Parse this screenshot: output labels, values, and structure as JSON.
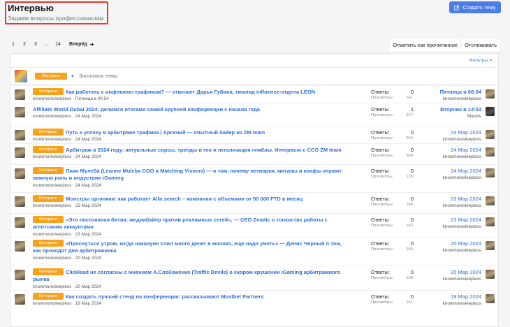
{
  "header": {
    "title": "Интервью",
    "description": "Задаем вопросы профессионалам",
    "create_button": "Создать тему"
  },
  "pagination": {
    "pages": [
      "1",
      "2",
      "3",
      "...",
      "14"
    ],
    "next_label": "Вперёд"
  },
  "actions": {
    "mark_read": "Отметить как прочитанное",
    "watch": "Отслеживать"
  },
  "filters_label": "Фильтры",
  "new_thread": {
    "prefix": "Интервью",
    "placeholder": "Заголовок темы"
  },
  "labels": {
    "replies": "Ответы:",
    "views": "Просмотры:"
  },
  "threads": [
    {
      "prefix": "Интервью",
      "title": "Как работать с инфлюенс-трафиком? — отвечает Дарья Губина, тимлид influence-отдела LEON",
      "author": "knowmoresleepless",
      "date": "Пятница в 00:54",
      "replies": "0",
      "views": "141",
      "last_date": "Пятница в 00:54",
      "last_user": "knowmoresleepless"
    },
    {
      "prefix": "",
      "title": "Affiliate World Dubai 2024: делимся итогами самой крупной конференции с начала года",
      "author": "knowmoresleepless",
      "date": "24 Мар 2024",
      "replies": "1",
      "views": "227",
      "last_date": "Вторник в 14:53",
      "last_user": "Maslov"
    },
    {
      "prefix": "Интервью",
      "title": "Путь к успеху в арбитраже трафика | Арсений — опытный байер из ZM team",
      "author": "knowmoresleepless",
      "date": "24 Мар 2024",
      "replies": "0",
      "views": "254",
      "last_date": "24 Мар 2024",
      "last_user": "knowmoresleepless"
    },
    {
      "prefix": "Интервью",
      "title": "Арбитраж в 2024 году: актуальные сорсы, тренды в гео и легализация гемблы. Интервью с CCO ZM team",
      "author": "knowmoresleepless",
      "date": "24 Мар 2024",
      "replies": "0",
      "views": "304",
      "last_date": "24 Мар 2024",
      "last_user": "knowmoresleepless"
    },
    {
      "prefix": "Интервью",
      "title": "Лиан Мулеба (Leanne Muleba COO в Matching Visions) — о том, почему нетворки, митапы и конфы играют важную роль в индустрии iGaming",
      "author": "knowmoresleepless",
      "date": "24 Мар 2024",
      "replies": "0",
      "views": "135",
      "last_date": "24 Мар 2024",
      "last_user": "knowmoresleepless"
    },
    {
      "prefix": "Интервью",
      "title": "Монстры органики: как работает Alfa:search – компания с объемами от 50 000 FTD в месяц",
      "author": "knowmoresleepless",
      "date": "23 Мар 2024",
      "replies": "0",
      "views": "146",
      "last_date": "23 Мар 2024",
      "last_user": "knowmoresleepless"
    },
    {
      "prefix": "Интервью",
      "title": "«Это постоянная битва: медиабайер против рекламных сетей», — CEO Zmatic о тонкостях работы с агентскими аккаунтами",
      "author": "knowmoresleepless",
      "date": "23 Мар 2024",
      "replies": "0",
      "views": "143",
      "last_date": "23 Мар 2024",
      "last_user": "knowmoresleepless"
    },
    {
      "prefix": "Интервью",
      "title": "«Проснуться утром, когда накануне слил много денег в молоко, еще надо уметь» — Денис Черный о том, как проходят дни арбитражника",
      "author": "knowmoresleepless",
      "date": "20 Мар 2024",
      "replies": "0",
      "views": "203",
      "last_date": "20 Мар 2024",
      "last_user": "knowmoresleepless"
    },
    {
      "prefix": "Интервью",
      "title": "Clicklead не согласны с мнением А.Слобоженко (Traffic Devils) о скором крушении iGaming арбитражного рынка",
      "author": "knowmoresleepless",
      "date": "20 Мар 2024",
      "replies": "0",
      "views": "158",
      "last_date": "20 Мар 2024",
      "last_user": "knowmoresleepless"
    },
    {
      "prefix": "Интервью",
      "title": "Как создать лучший стенд на конференции: рассказывают Mostbet Partners",
      "author": "knowmoresleepless",
      "date": "19 Мар 2024",
      "replies": "0",
      "views": "161",
      "last_date": "19 Мар 2024",
      "last_user": "knowmoresleepless"
    }
  ]
}
